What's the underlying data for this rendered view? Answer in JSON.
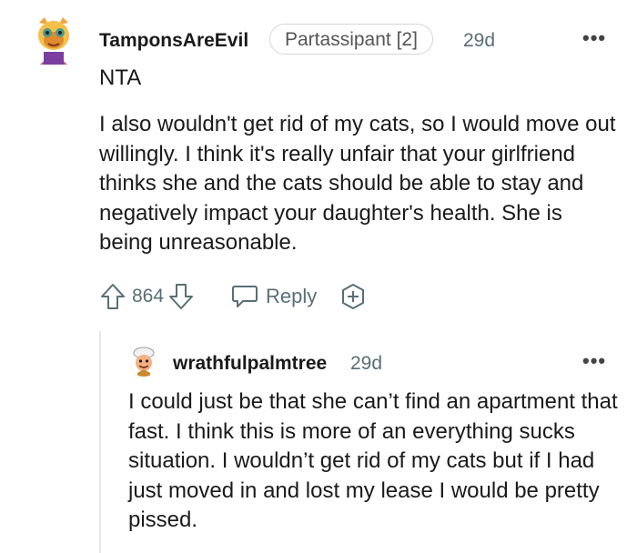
{
  "comment": {
    "username": "TamponsAreEvil",
    "flair": "Partassipant [2]",
    "age": "29d",
    "more_label": "•••",
    "verdict": "NTA",
    "body": "I also wouldn't get rid of my cats, so I would move out willingly. I think it's really unfair that your girlfriend thinks she and the cats should be able to stay and negatively impact your daughter's health. She is being unreasonable.",
    "score": "864",
    "reply_label": "Reply"
  },
  "reply": {
    "username": "wrathfulpalmtree",
    "age": "29d",
    "more_label": "•••",
    "body": "I could just be that she can’t find an apartment that fast. I think this is more of an everything sucks situation. I wouldn’t get rid of my cats but if I had just moved in and lost my lease I would be pretty pissed."
  },
  "colors": {
    "text": "#1a1a1b",
    "meta": "#576f76",
    "thread_line": "#e5e7eb"
  },
  "icons": {
    "upvote": "arrow-up-icon",
    "downvote": "arrow-down-icon",
    "reply": "speech-bubble-icon",
    "award": "plus-circle-icon",
    "more": "ellipsis-icon"
  }
}
